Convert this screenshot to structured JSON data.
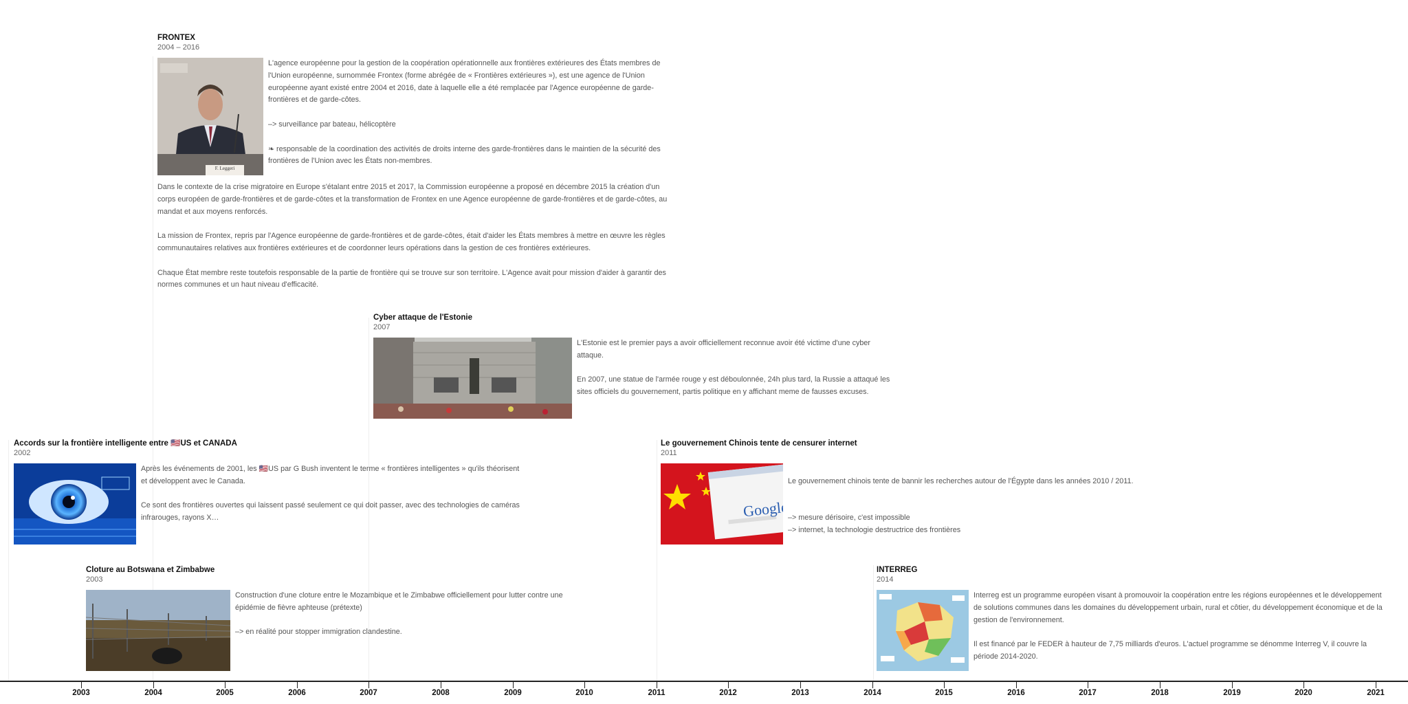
{
  "events": {
    "frontex": {
      "title": "FRONTEX",
      "date": "2004 – 2016",
      "side": [
        "L'agence européenne pour la gestion de la coopération opérationnelle aux frontières extérieures des États membres de l'Union européenne, surnommée Frontex (forme abrégée de « Frontières extérieures »), est une agence de l'Union européenne ayant existé entre 2004 et 2016, date à laquelle elle a été remplacée par l'Agence européenne de garde-frontières et de garde-côtes.",
        "–> surveillance par bateau, hélicoptère",
        "❧ responsable de la coordination des activités de droits interne des garde-frontières dans le maintien de la sécurité des frontières de l'Union avec les États non-membres."
      ],
      "below": [
        "Dans le contexte de la crise migratoire en Europe s'étalant entre 2015 et 2017, la Commission européenne a proposé en décembre 2015 la création d'un corps européen de garde-frontières et de garde-côtes et la transformation de Frontex en une Agence européenne de garde-frontières et de garde-côtes, au mandat et aux moyens renforcés.",
        "La mission de Frontex, repris par l'Agence européenne de garde-frontières et de garde-côtes, était d'aider les États membres à mettre en œuvre les règles communautaires relatives aux frontières extérieures et de coordonner leurs opérations dans la gestion de ces frontières extérieures.",
        "Chaque État membre reste toutefois responsable de la partie de frontière qui se trouve sur son territoire. L'Agence avait pour mission d'aider à garantir des normes communes et un haut niveau d'efficacité."
      ],
      "photo_caption": "F. Leggeri"
    },
    "estonia": {
      "title": "Cyber attaque de l'Estonie",
      "date": "2007",
      "side": [
        "L'Estonie est le premier pays a avoir officiellement reconnue avoir été victime d'une cyber attaque.",
        "En 2007, une statue de l'armée rouge y est déboulonnée, 24h plus tard, la Russie a attaqué les sites officiels du gouvernement, partis politique en y affichant meme de fausses excuses."
      ]
    },
    "smartborder": {
      "title": "Accords sur la frontière intelligente entre  🇺🇸US et CANADA",
      "date": "2002",
      "side": [
        "Après les événements de 2001, les 🇺🇸US par G Bush inventent le terme « frontières intelligentes » qu'ils théorisent et développent avec le Canada.",
        "Ce sont des frontières ouvertes qui laissent passé seulement ce qui doit passer, avec des technologies de caméras infrarouges, rayons X…"
      ]
    },
    "china": {
      "title": "Le gouvernement Chinois tente de censurer internet",
      "date": "2011",
      "side": [
        "Le gouvernement chinois tente de bannir les recherches autour de l'Égypte dans les années 2010 / 2011.",
        "–> mesure dérisoire, c'est impossible\n–> internet, la technologie destructrice des frontières"
      ],
      "logo_text": "Google"
    },
    "botswana": {
      "title": "Cloture au Botswana et Zimbabwe",
      "date": "2003",
      "side": [
        "Construction d'une cloture entre le Mozambique et le Zimbabwe officiellement pour lutter contre une épidémie de fièvre aphteuse (prétexte)",
        "–> en réalité pour stopper immigration clandestine."
      ]
    },
    "interreg": {
      "title": "INTERREG",
      "date": "2014",
      "side": [
        "Interreg est un programme européen visant à promouvoir la coopération entre les régions européennes et le développement de solutions communes dans les domaines du développement urbain, rural et côtier, du développement économique et de la gestion de l'environnement.",
        "Il est financé par le FEDER à hauteur de 7,75 milliards d'euros. L'actuel programme se dénomme Interreg V, il couvre la période 2014-2020."
      ]
    }
  },
  "axis": {
    "years": [
      "2003",
      "2004",
      "2005",
      "2006",
      "2007",
      "2008",
      "2009",
      "2010",
      "2011",
      "2012",
      "2013",
      "2014",
      "2015",
      "2016",
      "2017",
      "2018",
      "2019",
      "2020",
      "2021"
    ]
  }
}
